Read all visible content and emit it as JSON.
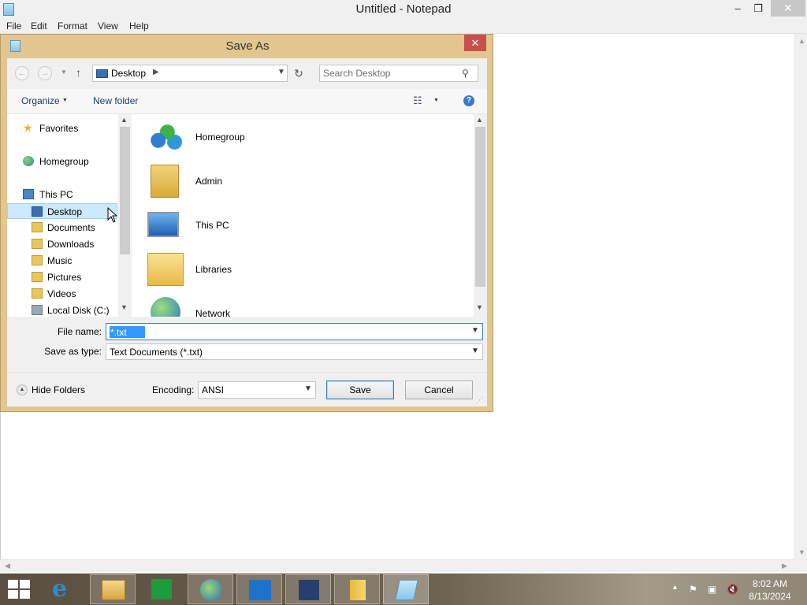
{
  "notepad": {
    "title": "Untitled - Notepad",
    "menu": [
      "File",
      "Edit",
      "Format",
      "View",
      "Help"
    ],
    "controls": {
      "minimize": "–",
      "restore": "❐",
      "close": "✕"
    }
  },
  "dialog": {
    "title": "Save As",
    "close": "✕",
    "address": {
      "location": "Desktop",
      "search_placeholder": "Search Desktop"
    },
    "toolbar": {
      "organize": "Organize",
      "new_folder": "New folder"
    },
    "nav_pane": {
      "items": [
        {
          "label": "Favorites",
          "icon": "star-icon"
        },
        {
          "label": "Homegroup",
          "icon": "homegroup-icon"
        },
        {
          "label": "This PC",
          "icon": "computer-icon"
        },
        {
          "label": "Desktop",
          "icon": "desktop-folder-icon",
          "selected": true
        },
        {
          "label": "Documents",
          "icon": "documents-folder-icon"
        },
        {
          "label": "Downloads",
          "icon": "downloads-folder-icon"
        },
        {
          "label": "Music",
          "icon": "music-folder-icon"
        },
        {
          "label": "Pictures",
          "icon": "pictures-folder-icon"
        },
        {
          "label": "Videos",
          "icon": "videos-folder-icon"
        },
        {
          "label": "Local Disk (C:)",
          "icon": "drive-icon"
        }
      ]
    },
    "file_list": {
      "items": [
        {
          "label": "Homegroup",
          "icon": "homegroup-large-icon"
        },
        {
          "label": "Admin",
          "icon": "user-folder-icon"
        },
        {
          "label": "This PC",
          "icon": "computer-large-icon"
        },
        {
          "label": "Libraries",
          "icon": "libraries-icon"
        },
        {
          "label": "Network",
          "icon": "network-icon"
        }
      ]
    },
    "form": {
      "file_name_label": "File name:",
      "file_name_value": "*.txt",
      "save_type_label": "Save as type:",
      "save_type_value": "Text Documents (*.txt)",
      "encoding_label": "Encoding:",
      "encoding_value": "ANSI"
    },
    "footer": {
      "hide_folders": "Hide Folders",
      "save": "Save",
      "cancel": "Cancel"
    }
  },
  "taskbar": {
    "apps": [
      {
        "name": "internet-explorer-icon"
      },
      {
        "name": "file-explorer-icon"
      },
      {
        "name": "store-icon"
      },
      {
        "name": "globe-app-icon"
      },
      {
        "name": "remote-app-icon"
      },
      {
        "name": "install-app-icon"
      },
      {
        "name": "file-app-icon"
      },
      {
        "name": "notepad-icon",
        "active": true
      }
    ],
    "clock": {
      "time": "8:02 AM",
      "date": "8/13/2024"
    }
  }
}
